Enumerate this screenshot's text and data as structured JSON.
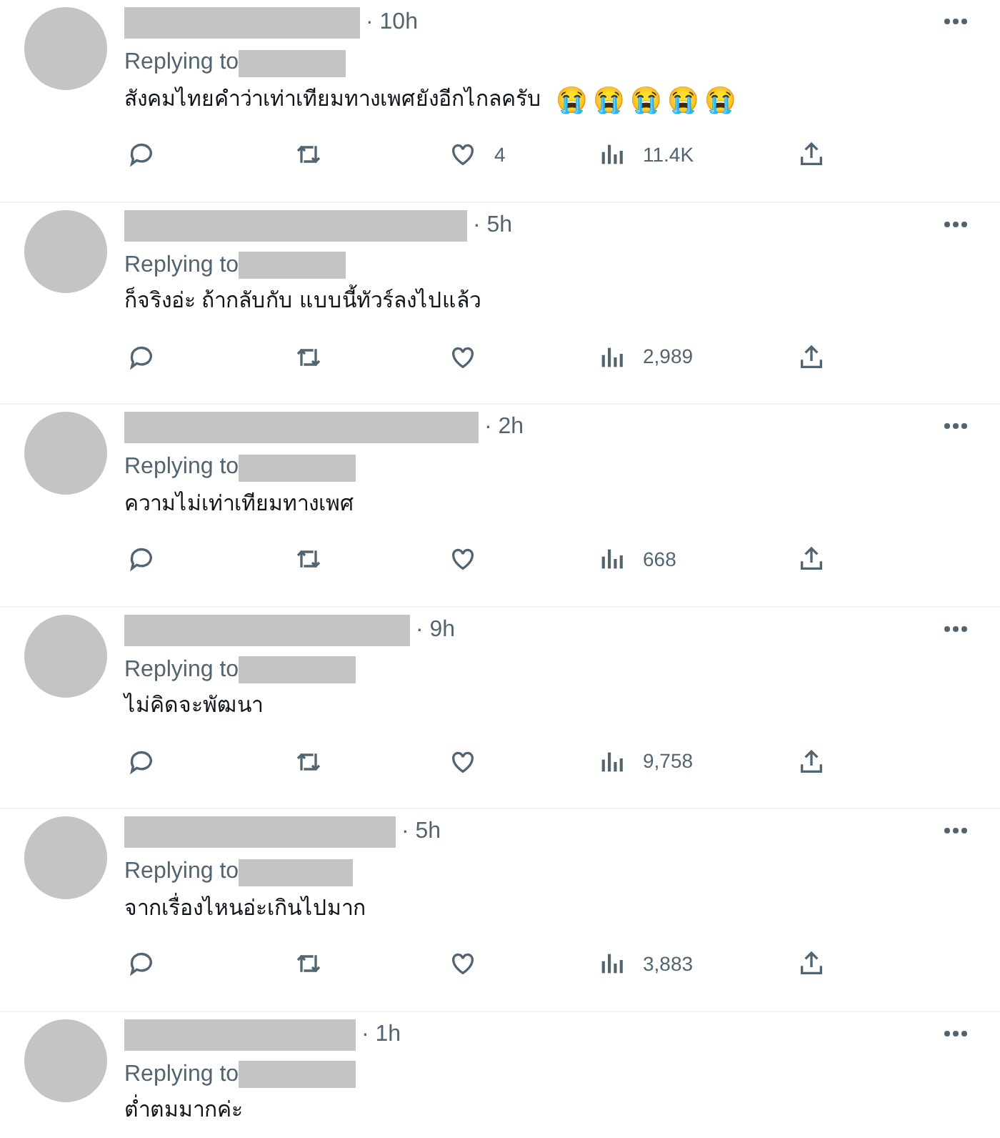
{
  "replies": [
    {
      "time": "· 10h",
      "replying_to": "Replying to",
      "text": "สังคมไทยคำว่าเท่าเทียมทางเพศยังอีกไกลครับ",
      "emojis": "😭😭😭😭😭",
      "likes": "4",
      "views": "11.4K"
    },
    {
      "time": "· 5h",
      "replying_to": "Replying to",
      "text": "ก็จริงอ่ะ ถ้ากลับกับ แบบนี้ทัวร์ลงไปแล้ว",
      "views": "2,989"
    },
    {
      "time": "· 2h",
      "replying_to": "Replying to",
      "text": "ความไม่เท่าเทียมทางเพศ",
      "views": "668"
    },
    {
      "time": "· 9h",
      "replying_to": "Replying to",
      "text": "ไม่คิดจะพัฒนา",
      "views": "9,758"
    },
    {
      "time": "· 5h",
      "replying_to": "Replying to",
      "text": "จากเรื่องไหนอ่ะเกินไปมาก",
      "views": "3,883"
    },
    {
      "time": "· 1h",
      "replying_to": "Replying to",
      "text": "ต่ำตมมากค่ะ"
    }
  ]
}
